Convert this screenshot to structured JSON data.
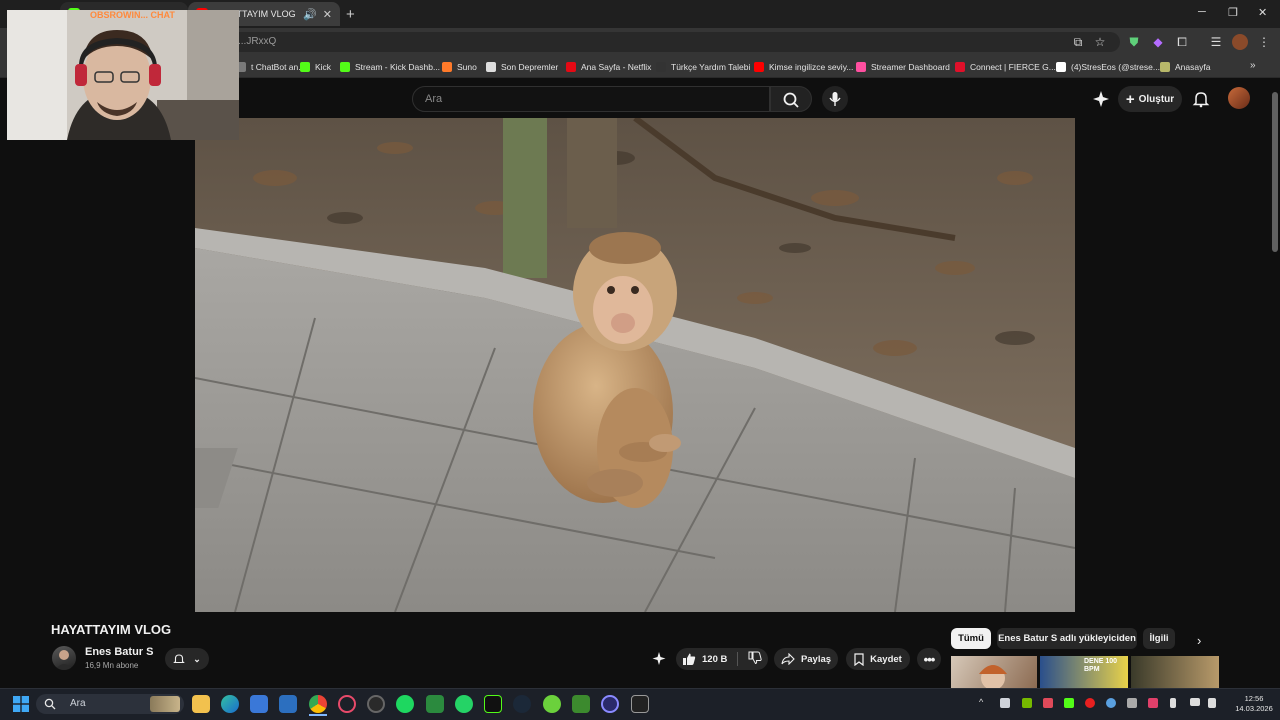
{
  "browser": {
    "tabs": [
      {
        "title": "OBSROWIN... CHAT"
      },
      {
        "title": "HAYATTAYIM VLOG - YouTube"
      }
    ],
    "url": "...JRxxQ",
    "bookmarks": [
      {
        "label": "t ChatBot an...",
        "color": "#7a7a7a"
      },
      {
        "label": "Kick",
        "color": "#53fc18"
      },
      {
        "label": "Stream - Kick Dashb...",
        "color": "#53fc18"
      },
      {
        "label": "Suno",
        "color": "#ff7a2a"
      },
      {
        "label": "Son Depremler",
        "color": "#dddddd"
      },
      {
        "label": "Ana Sayfa - Netflix",
        "color": "#e50914"
      },
      {
        "label": "Türkçe Yardım Talebi",
        "color": "#333333"
      },
      {
        "label": "Kimse ingilizce seviy...",
        "color": "#ff0000"
      },
      {
        "label": "Streamer Dashboard",
        "color": "#ff4fa0"
      },
      {
        "label": "Connect | FIERCE G...",
        "color": "#e0102a"
      },
      {
        "label": "(4)StresEos (@strese...",
        "color": "#ffffff"
      },
      {
        "label": "Anasayfa",
        "color": "#b8b86a"
      }
    ]
  },
  "youtube": {
    "search_placeholder": "Ara",
    "create_label": "Oluştur",
    "video_title": "HAYATTAYIM VLOG",
    "channel_name": "Enes Batur S",
    "channel_subs": "16,9 Mn abone",
    "like_count": "120 B",
    "share_label": "Paylaş",
    "save_label": "Kaydet",
    "chips": [
      "Tümü",
      "Enes Batur S adlı yükleyiciden",
      "İlgili"
    ],
    "thumb_overlay": "DENE 100 BPM"
  },
  "taskbar": {
    "search_placeholder": "Ara",
    "time": "12:56",
    "date": "14.03.2026"
  },
  "colors": {
    "yt_bg": "#0f0f0f",
    "pill_bg": "#272727",
    "accent_red": "#ff0000"
  }
}
